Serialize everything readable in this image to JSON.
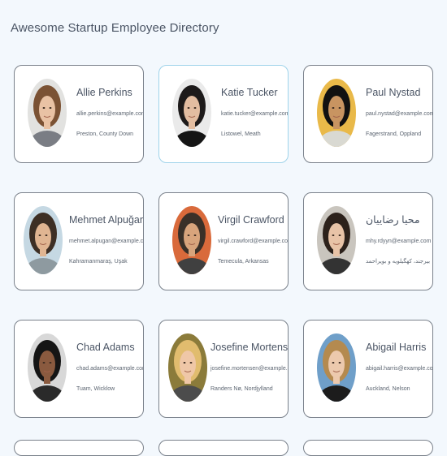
{
  "page": {
    "title": "Awesome Startup Employee Directory"
  },
  "employees": [
    {
      "name": "Allie Perkins",
      "email": "allie.perkins@example.com",
      "location": "Preston, County Down",
      "avatar_colors": {
        "bg": "#e2e2e0",
        "hair": "#7b5234",
        "skin": "#e9c2a4",
        "clothes": "#7a7d84"
      }
    },
    {
      "name": "Katie Tucker",
      "email": "katie.tucker@example.com",
      "location": "Listowel, Meath",
      "avatar_colors": {
        "bg": "#eaeaea",
        "hair": "#1d1a1a",
        "skin": "#e3bda1",
        "clothes": "#151515"
      }
    },
    {
      "name": "Paul Nystad",
      "email": "paul.nystad@example.com",
      "location": "Fagerstrand, Oppland",
      "avatar_colors": {
        "bg": "#e9b949",
        "hair": "#111111",
        "skin": "#c89461",
        "clothes": "#d9d9d2"
      }
    },
    {
      "name": "Mehmet Alpuğan",
      "email": "mehmet.alpugan@example.com",
      "location": "Kahramanmaraş, Uşak",
      "avatar_colors": {
        "bg": "#c5d8e3",
        "hair": "#3d2f25",
        "skin": "#e0b592",
        "clothes": "#8e9aa0"
      }
    },
    {
      "name": "Virgil Crawford",
      "email": "virgil.crawford@example.com",
      "location": "Temecula, Arkansas",
      "avatar_colors": {
        "bg": "#d96a3b",
        "hair": "#3a3028",
        "skin": "#d8a47c",
        "clothes": "#404040"
      }
    },
    {
      "name": "محیا رضاییان",
      "email": "mhy.rdyyn@example.com",
      "location": "بیرجند، کهگیلویه و بویراحمد",
      "avatar_colors": {
        "bg": "#c9c5be",
        "hair": "#2c211b",
        "skin": "#e8c3a7",
        "clothes": "#333333"
      }
    },
    {
      "name": "Chad Adams",
      "email": "chad.adams@example.com",
      "location": "Tuam, Wicklow",
      "avatar_colors": {
        "bg": "#d8d8d8",
        "hair": "#151515",
        "skin": "#8a5a3f",
        "clothes": "#2a2a2a"
      }
    },
    {
      "name": "Josefine Mortensen",
      "email": "josefine.mortensen@example.com",
      "location": "Randers Nø, Nordjylland",
      "avatar_colors": {
        "bg": "#8b7b3a",
        "hair": "#e1bc6e",
        "skin": "#efc7a7",
        "clothes": "#4c4c4c"
      }
    },
    {
      "name": "Abigail Harris",
      "email": "abigail.harris@example.com",
      "location": "Auckland, Nelson",
      "avatar_colors": {
        "bg": "#6f9fc9",
        "hair": "#b48a4f",
        "skin": "#ecc9ad",
        "clothes": "#1c1c1c"
      }
    }
  ]
}
